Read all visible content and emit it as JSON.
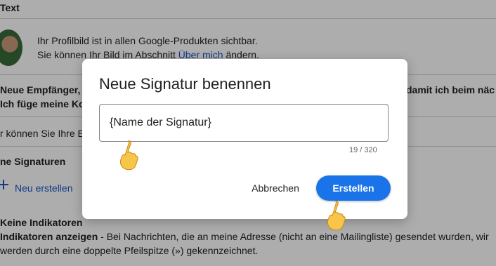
{
  "background": {
    "section_label": "Text",
    "profile_line1": "Ihr Profilbild ist in allen Google-Produkten sichtbar.",
    "profile_line2_prefix": "Sie können Ihr Bild im Abschnitt ",
    "profile_link": "Über mich",
    "profile_line2_suffix": " ändern.",
    "recipients_left1": "Neue Empfänger,",
    "recipients_left2": "Ich füge meine Ko",
    "recipients_right": "damit ich beim näc",
    "signature_hint": "r können Sie Ihre Ei",
    "my_signatures": "ne Signaturen",
    "new_create": "Neu erstellen",
    "no_indicators": "Keine Indikatoren",
    "indicators_bold": "Indikatoren anzeigen",
    "indicators_text": " - Bei Nachrichten, die an meine Adresse (nicht an eine Mailingliste) gesendet wurden, wir",
    "indicators_text2": "werden durch eine doppelte Pfeilspitze (») gekennzeichnet."
  },
  "dialog": {
    "title": "Neue Signatur benennen",
    "input_placeholder": "{Name der Signatur}",
    "counter": "19 / 320",
    "cancel_label": "Abbrechen",
    "create_label": "Erstellen"
  },
  "colors": {
    "accent": "#1a73e8",
    "link": "#1a57c8",
    "scrim": "rgba(0,0,0,0.32)"
  }
}
